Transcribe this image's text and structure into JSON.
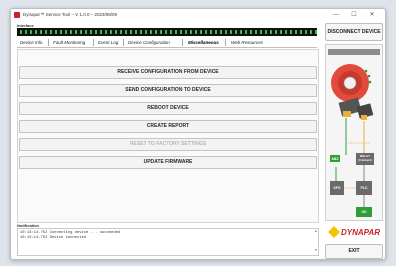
{
  "window": {
    "title": "Dynapar™ Service Tool – V 1.0.0 – 2023/08/09",
    "minimize_glyph": "—",
    "maximize_glyph": "☐",
    "close_glyph": "✕"
  },
  "interface": {
    "label": "Interface"
  },
  "header": {
    "disconnect_label": "DISCONNECT DEVICE"
  },
  "tabs": [
    {
      "label": "Device Info",
      "active": false
    },
    {
      "label": "Fault Monitoring",
      "active": false
    },
    {
      "label": "Event Log",
      "active": false
    },
    {
      "label": "Device Configuration",
      "active": false
    },
    {
      "label": "Miscellaneous",
      "active": true
    },
    {
      "label": "Web Resources",
      "active": false
    }
  ],
  "actions": [
    {
      "label": "RECEIVE CONFIGURATION FROM DEVICE",
      "enabled": true
    },
    {
      "label": "SEND CONFIGURATION TO DEVICE",
      "enabled": true
    },
    {
      "label": "REBOOT DEVICE",
      "enabled": true
    },
    {
      "label": "CREATE REPORT",
      "enabled": true
    },
    {
      "label": "RESET TO FACTORY SETTINGS",
      "enabled": false
    },
    {
      "label": "UPDATE FIRMWARE",
      "enabled": true
    }
  ],
  "notifications": {
    "label": "Notification",
    "lines": [
      "10:13:14.752 Connecting device ... succeeded",
      "10:13:14.752 Device connected"
    ]
  },
  "diagram": {
    "pin_labels": [
      "ABZ",
      "RELAY (Contact)",
      "SFO",
      "PLC",
      "OK"
    ],
    "colors": {
      "encoder_body": "#e24a3c",
      "connector": "#555555",
      "green": "#2e9e3b",
      "yellow": "#e8b13a",
      "box": "#6a6a6a"
    }
  },
  "brand": {
    "logo_text": "DYNAPAR",
    "logo_color": "#c8202e",
    "accent": "#f2c300"
  },
  "footer": {
    "exit_label": "EXIT"
  }
}
